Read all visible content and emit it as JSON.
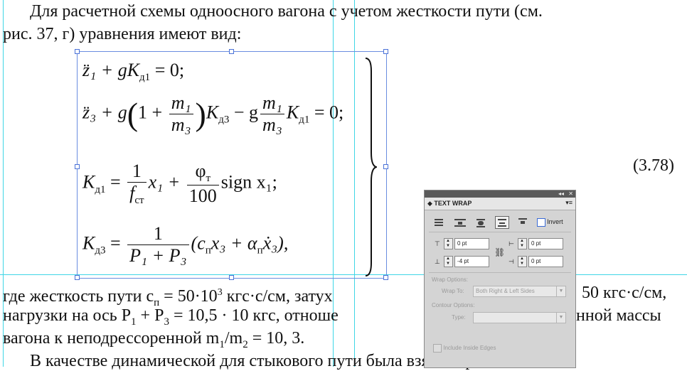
{
  "text": {
    "l1": "Для расчетной схемы одноосного вагона с учетом жесткости пути (см.",
    "l2": "рис. 37, г) уравнения имеют вид:",
    "l3": "где жесткость пути c",
    "l3b": "п",
    "l3c": " = 50·10",
    "l3d": "3",
    "l3e": " кгс·с/см, затух",
    "l3f": "50 кгс·с/см,",
    "l4": "нагрузки на ось P",
    "l4b": "1",
    "l4c": " + P",
    "l4d": "3",
    "l4e": " = 10,5 · 10 кгс, отноше",
    "l4f": "нной массы",
    "l5": "вагона к неподрессоренной m",
    "l5b": "1",
    "l5c": "/m",
    "l5d": "2",
    "l5e": " = 10, 3.",
    "l6": "В качестве динамической для стыкового пути была взята неровность"
  },
  "equations": {
    "e1": "z̈₁ + gK",
    "e1s": "д1",
    "e1e": " = 0;",
    "e2a": "z̈₃ + g",
    "e2n": "m₁",
    "e2d": "m₃",
    "e2b": "K",
    "e2s": "д3",
    "e2c": " − g",
    "e2n2": "m₁",
    "e2d2": "m₃",
    "e2e": "K",
    "e2s2": "д1",
    "e2f": " = 0;",
    "e3a": "K",
    "e3s": "д1",
    "e3b": " = ",
    "e3n": "1",
    "e3d": "f",
    "e3ds": "ст",
    "e3c": "x₁ + ",
    "e3n2": "φ",
    "e3n2s": "т",
    "e3d2": "100",
    "e3e": "sign x₁;",
    "e4a": "K",
    "e4s": "д3",
    "e4b": " = ",
    "e4n": "1",
    "e4d": "P₁ + P₃",
    "e4c": "(c",
    "e4cs": "п",
    "e4e": "x₃ + α",
    "e4es": "п",
    "e4f": "ẋ₃),",
    "number": "(3.78)"
  },
  "panel": {
    "title": "TEXT WRAP",
    "collapse": "◂◂",
    "close": "✕",
    "menu": "▾≡",
    "invert": "Invert",
    "top_offset": "0 pt",
    "bottom_offset": "-4 pt",
    "left_offset": "0 pt",
    "right_offset": "0 pt",
    "wrap_options": "Wrap Options:",
    "wrap_to_label": "Wrap To:",
    "wrap_to_value": "Both Right & Left Sides",
    "contour_options": "Contour Options:",
    "type_label": "Type:",
    "type_value": "",
    "include_inside_edges": "Include Inside Edges"
  }
}
